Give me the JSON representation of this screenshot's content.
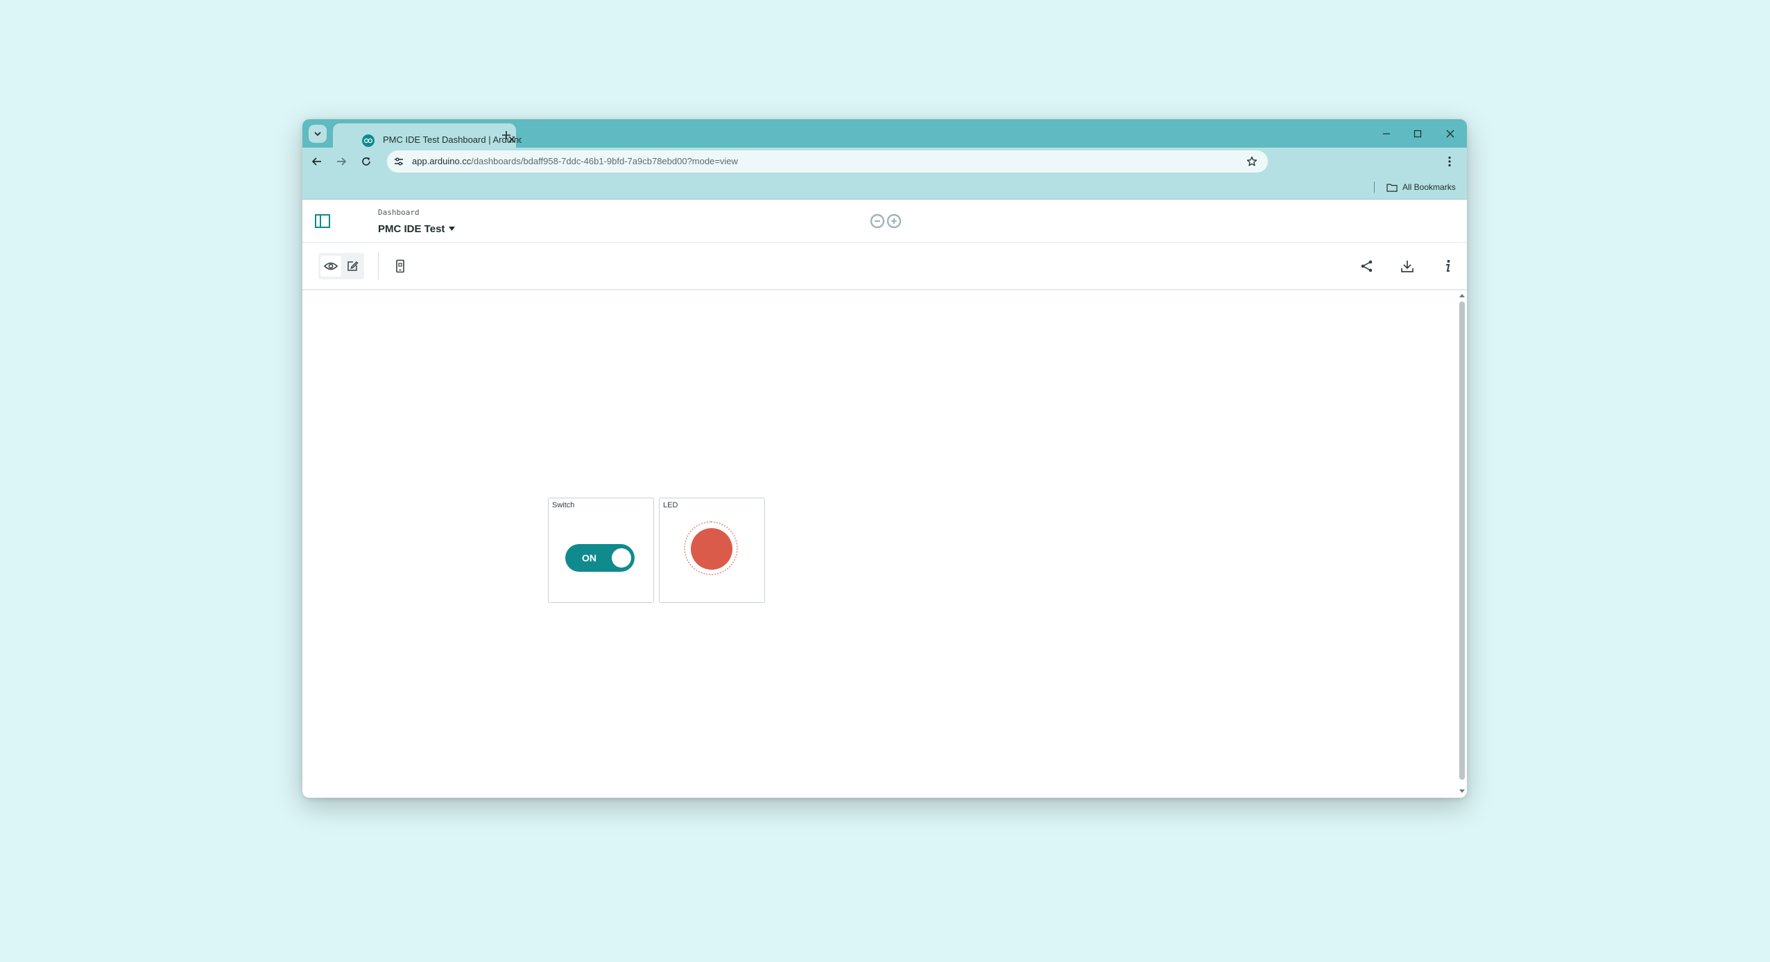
{
  "browser": {
    "tab": {
      "title": "PMC IDE Test Dashboard | Arduino"
    },
    "address": {
      "host": "app.arduino.cc",
      "path": "/dashboards/bdaff958-7ddc-46b1-9bfd-7a9cb78ebd00?mode=view"
    },
    "bookmarks": {
      "all_label": "All Bookmarks"
    }
  },
  "header": {
    "breadcrumb": "Dashboard",
    "title": "PMC IDE Test"
  },
  "widgets": [
    {
      "title": "Switch",
      "state_label": "ON",
      "value": true
    },
    {
      "title": "LED",
      "value": true
    }
  ],
  "colors": {
    "accent": "#0f8b8d",
    "titlebar": "#5fbac1",
    "toolbar": "#b5e0e3",
    "led_on": "#da5b4a",
    "background": "#dcf5f6"
  },
  "icons": {
    "tab_search": "chevron-down-icon",
    "back": "arrow-left-icon",
    "forward": "arrow-right-icon",
    "reload": "reload-icon",
    "site_info": "tune-icon",
    "bookmark": "star-icon",
    "menu": "kebab-menu-icon",
    "sidebar": "sidebar-panel-icon",
    "view_mode": "eye-icon",
    "edit_mode": "pencil-icon",
    "device": "phone-icon",
    "share": "share-icon",
    "download": "download-icon",
    "info": "info-icon"
  }
}
